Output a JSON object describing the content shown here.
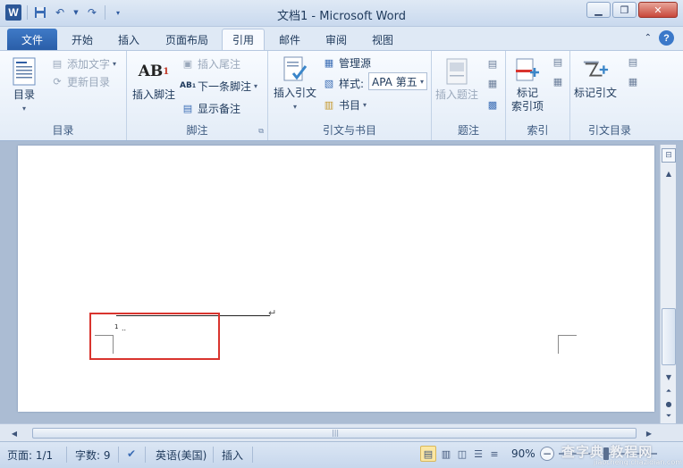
{
  "window": {
    "title": "文档1 - Microsoft Word",
    "app_icon": "W",
    "controls": [
      "minimize-icon",
      "restore-icon",
      "close-icon"
    ]
  },
  "qat": {
    "icons": [
      "save-icon",
      "undo-icon",
      "redo-icon",
      "customize-icon"
    ]
  },
  "tabs": {
    "file": "文件",
    "items": [
      "开始",
      "插入",
      "页面布局",
      "引用",
      "邮件",
      "审阅",
      "视图"
    ],
    "active": "引用"
  },
  "ribbon": {
    "toc": {
      "label": "目录",
      "button": "目录",
      "add_text": "添加文字",
      "update_toc": "更新目录"
    },
    "footnotes": {
      "label": "脚注",
      "insert_footnote": "插入脚注",
      "insert_endnote": "插入尾注",
      "next_footnote": "下一条脚注",
      "show_notes": "显示备注",
      "ab_glyph": "AB",
      "ab_sup": "1"
    },
    "citations": {
      "label": "引文与书目",
      "insert_citation": "插入引文",
      "manage_sources": "管理源",
      "style_label": "样式:",
      "style_value": "APA 第五",
      "bibliography": "书目"
    },
    "captions": {
      "label": "题注",
      "insert_caption": "插入题注"
    },
    "index": {
      "label": "索引",
      "mark_entry_line1": "标记",
      "mark_entry_line2": "索引项"
    },
    "toa": {
      "label": "引文目录",
      "mark_citation": "标记引文"
    }
  },
  "document": {
    "footnote_ref": "1",
    "footnote_dots": "..",
    "paragraph_mark": "↵"
  },
  "status": {
    "page": "页面: 1/1",
    "words": "字数: 9",
    "language": "英语(美国)",
    "mode": "插入",
    "zoom": "90%",
    "zoom_fraction": 0.9
  },
  "watermark": {
    "main": "查字典 教程网",
    "sub": "jiaocheng.chazidian.com"
  },
  "colors": {
    "accent": "#2a5ea8",
    "highlight_box": "#d9342e",
    "ribbon_bg": "#f8fbff"
  }
}
